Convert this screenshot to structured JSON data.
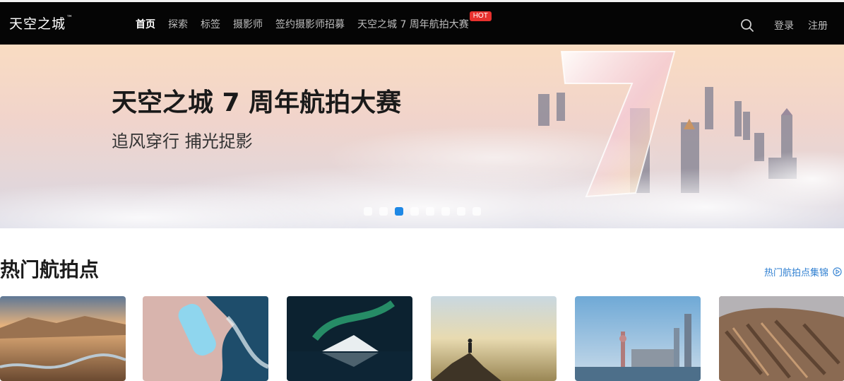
{
  "header": {
    "logo": "天空之城",
    "logo_mark": "™",
    "nav": [
      {
        "label": "首页",
        "active": true
      },
      {
        "label": "探索"
      },
      {
        "label": "标签"
      },
      {
        "label": "摄影师"
      },
      {
        "label": "签约摄影师招募"
      },
      {
        "label": "天空之城 7 周年航拍大赛",
        "badge": "HOT"
      }
    ],
    "search_icon": "search-icon",
    "login": "登录",
    "register": "注册"
  },
  "banner": {
    "title": "天空之城 7 周年航拍大赛",
    "subtitle": "追风穿行 捕光捉影",
    "slide_count": 8,
    "active_slide": 3
  },
  "section": {
    "title": "热门航拍点",
    "more_link": "热门航拍点集锦",
    "more_icon": "play-circle-icon"
  },
  "cards": [
    {
      "name": "desert-river"
    },
    {
      "name": "pool-on-rocks"
    },
    {
      "name": "aurora-mountain"
    },
    {
      "name": "hiker-on-peak"
    },
    {
      "name": "city-skyline"
    },
    {
      "name": "mountain-ridges"
    }
  ],
  "colors": {
    "topbar": "#050505",
    "accent": "#1e88e5",
    "hot_badge": "#e8312e",
    "link": "#2f7fd1"
  }
}
